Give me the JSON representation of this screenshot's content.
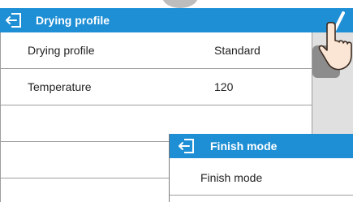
{
  "header": {
    "title": "Drying profile",
    "back_icon": "back-arrow-icon",
    "confirm_icon": "checkmark-icon"
  },
  "rows": [
    {
      "label": "Drying profile",
      "value": "Standard"
    },
    {
      "label": "Temperature",
      "value": "120"
    }
  ],
  "popup": {
    "title": "Finish mode",
    "back_icon": "back-arrow-icon",
    "rows": [
      {
        "label": "Finish mode"
      }
    ]
  },
  "colors": {
    "accent": "#1e8fd5",
    "side_panel": "#e0e0e0"
  },
  "icons": {
    "hand": "pointing-hand-icon"
  }
}
